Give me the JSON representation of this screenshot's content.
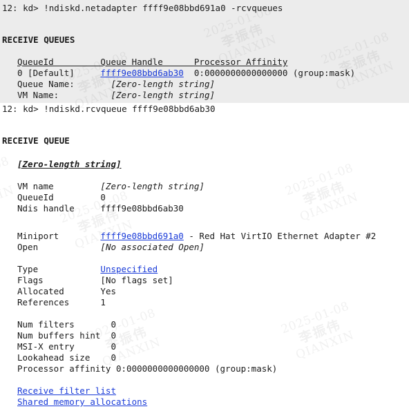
{
  "theme": {
    "background": "#ffffff",
    "band_background": "#ececec",
    "text_color": "#1a1a1a",
    "link_color": "#1a3bd8"
  },
  "watermark": {
    "date": "2025-01-08",
    "name": "李振伟",
    "org": "QIANXIN"
  },
  "command_1": {
    "prompt": "12: kd>",
    "text": " !ndiskd.netadapter ffff9e08bbd691a0 -rcvqueues"
  },
  "receive_queues": {
    "heading": "RECEIVE QUEUES",
    "columns": [
      "QueueId         ",
      "Queue Handle      ",
      "Processor Affinity"
    ],
    "rows": [
      {
        "queue_id": "0 [Default]     ",
        "queue_handle": "ffff9e08bbd6ab30",
        "handle_pad": "  ",
        "processor_affinity": "0:0000000000000000 (group:mask)"
      }
    ],
    "sub_rows": [
      {
        "label": "Queue Name:     ",
        "pad": "  ",
        "value": "[Zero-length string]"
      },
      {
        "label": "VM Name:        ",
        "pad": "  ",
        "value": "[Zero-length string]"
      }
    ]
  },
  "command_2": {
    "prompt": "12: kd>",
    "text": " !ndiskd.rcvqueue ffff9e08bbd6ab30"
  },
  "receive_queue": {
    "heading": "RECEIVE QUEUE",
    "title": "[Zero-length string]",
    "group_1": [
      {
        "label": "VM name         ",
        "value": "[Zero-length string]",
        "style": "italic"
      },
      {
        "label": "QueueId         ",
        "value": "0",
        "style": "plain"
      },
      {
        "label": "Ndis handle     ",
        "value": "ffff9e08bbd6ab30",
        "style": "plain"
      }
    ],
    "group_2": {
      "miniport_label": "Miniport        ",
      "miniport_link": "ffff9e08bbd691a0",
      "miniport_suffix": " - Red Hat VirtIO Ethernet Adapter #2",
      "open_label": "Open            ",
      "open_value": "[No associated Open]"
    },
    "group_3": {
      "type_label": "Type            ",
      "type_link": "Unspecified",
      "rows": [
        {
          "label": "Flags           ",
          "value": "[No flags set]"
        },
        {
          "label": "Allocated       ",
          "value": "Yes"
        },
        {
          "label": "References      ",
          "value": "1"
        }
      ]
    },
    "group_4": [
      {
        "label": "Num filters       ",
        "value": "0"
      },
      {
        "label": "Num buffers hint  ",
        "value": "0"
      },
      {
        "label": "MSI-X entry       ",
        "value": "0"
      },
      {
        "label": "Lookahead size    ",
        "value": "0"
      },
      {
        "label": "Processor affinity ",
        "value": "0:0000000000000000 (group:mask)"
      }
    ],
    "links": [
      "Receive filter list",
      "Shared memory allocations"
    ]
  }
}
